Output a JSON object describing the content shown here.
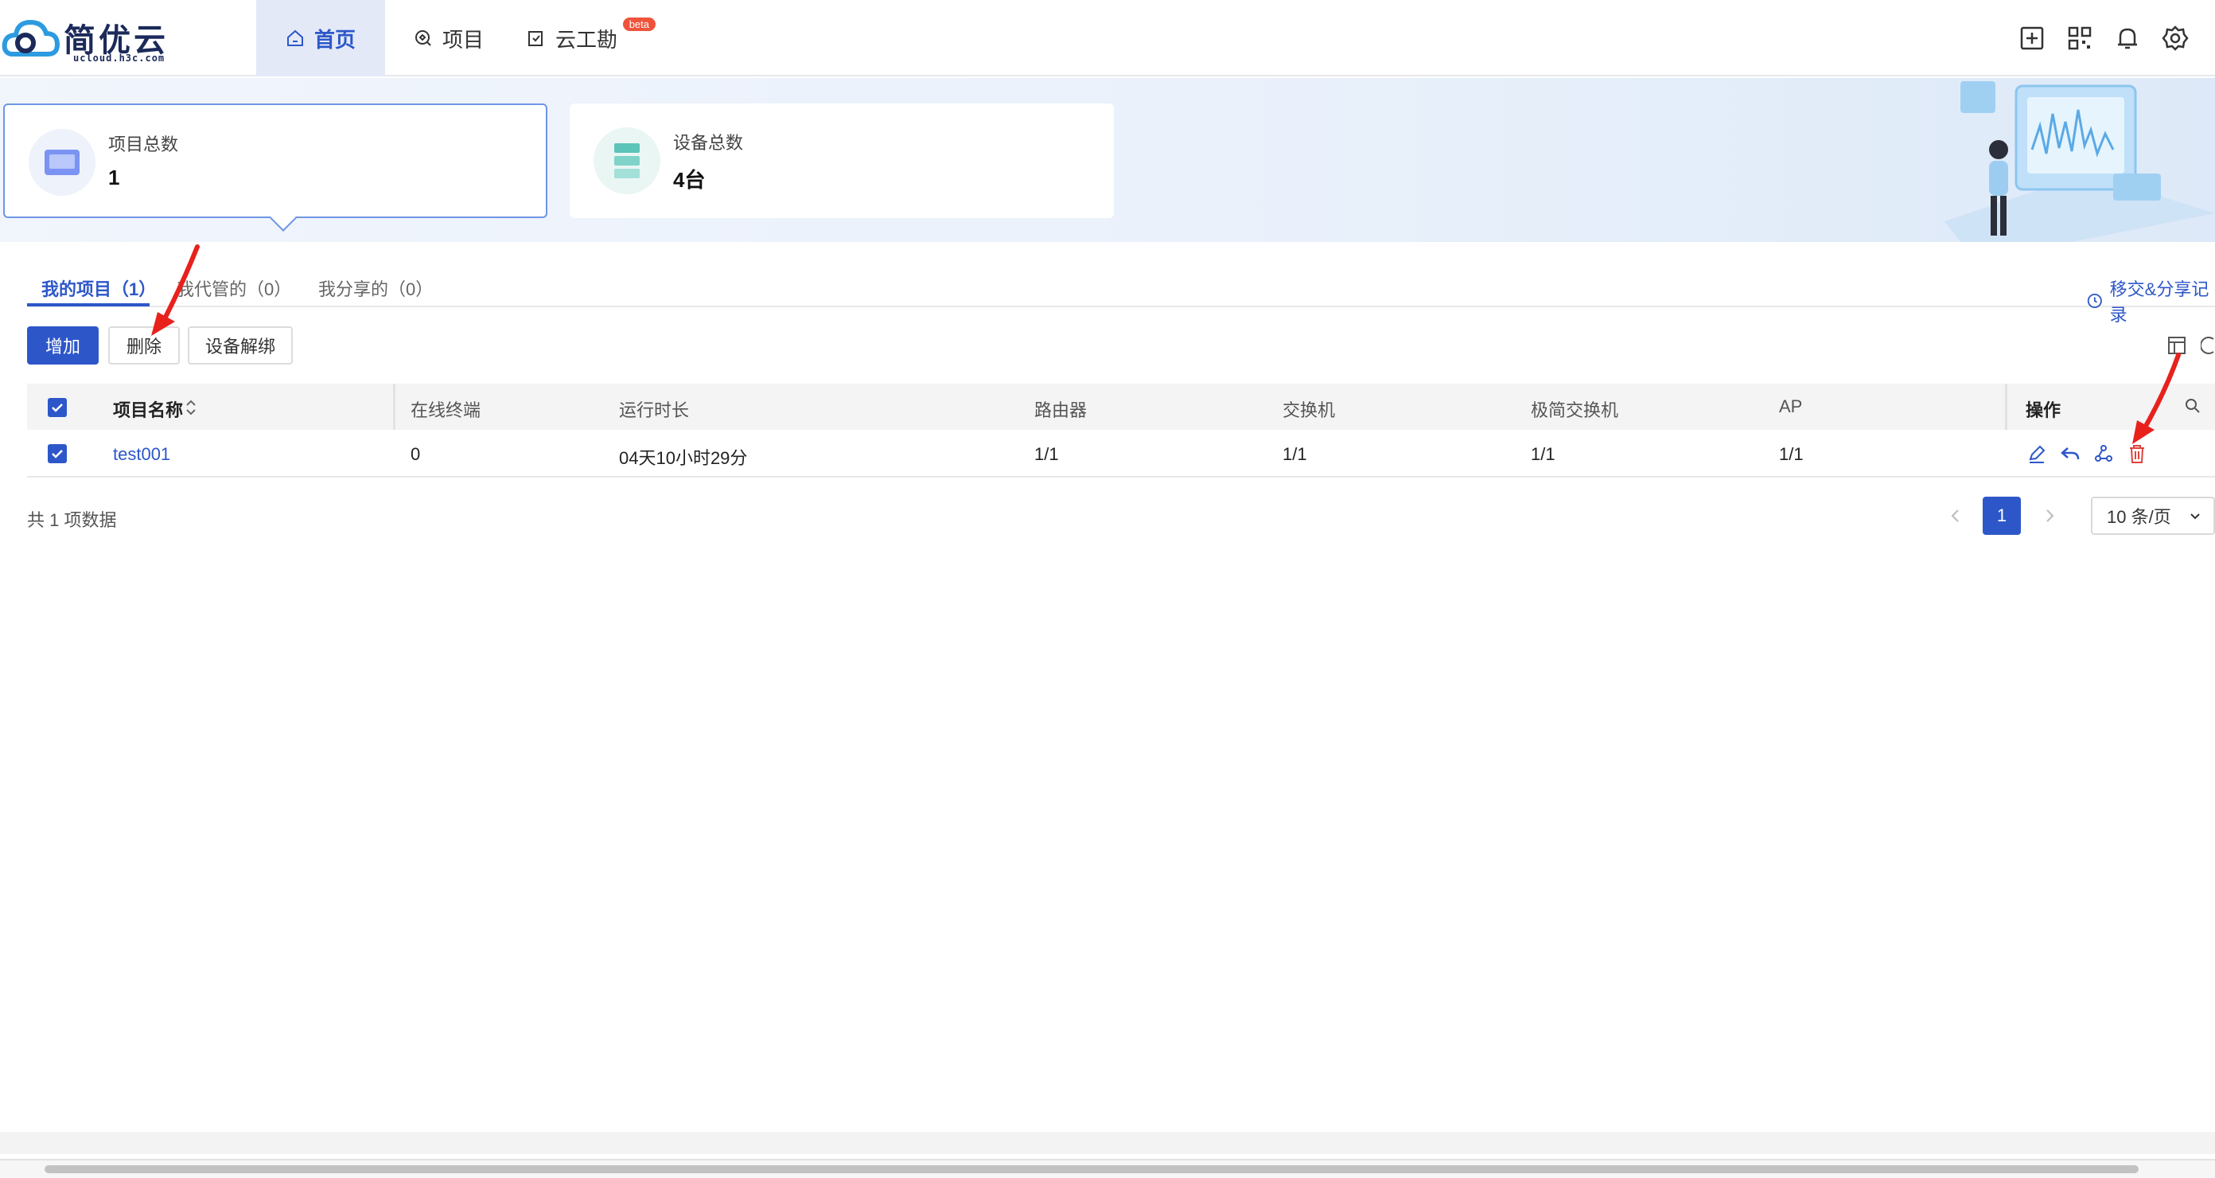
{
  "brand": {
    "name": "简优云",
    "domain": "ucloud.h3c.com"
  },
  "nav": {
    "home": "首页",
    "projects": "项目",
    "survey": "云工勘",
    "survey_badge": "beta"
  },
  "toolbar_icons": [
    "add-square-icon",
    "qrcode-icon",
    "bell-icon",
    "gear-icon"
  ],
  "stats": {
    "projects": {
      "label": "项目总数",
      "value": "1"
    },
    "devices": {
      "label": "设备总数",
      "value": "4台"
    }
  },
  "tabs": {
    "mine": "我的项目（1）",
    "managed": "我代管的（0）",
    "shared": "我分享的（0）",
    "records": "移交&分享记录"
  },
  "buttons": {
    "add": "增加",
    "delete": "删除",
    "unbind": "设备解绑"
  },
  "table": {
    "headers": {
      "name": "项目名称",
      "online": "在线终端",
      "uptime": "运行时长",
      "router": "路由器",
      "switch": "交换机",
      "simple_switch": "极简交换机",
      "ap": "AP",
      "ops": "操作"
    },
    "rows": [
      {
        "name": "test001",
        "online": "0",
        "uptime": "04天10小时29分",
        "router": "1/1",
        "switch": "1/1",
        "simple_switch": "1/1",
        "ap": "1/1"
      }
    ]
  },
  "pagination": {
    "total": "共 1 项数据",
    "current": "1",
    "page_size": "10 条/页"
  },
  "colors": {
    "primary": "#2d57c9",
    "danger": "#e0433b",
    "annotation": "#e8211d"
  }
}
